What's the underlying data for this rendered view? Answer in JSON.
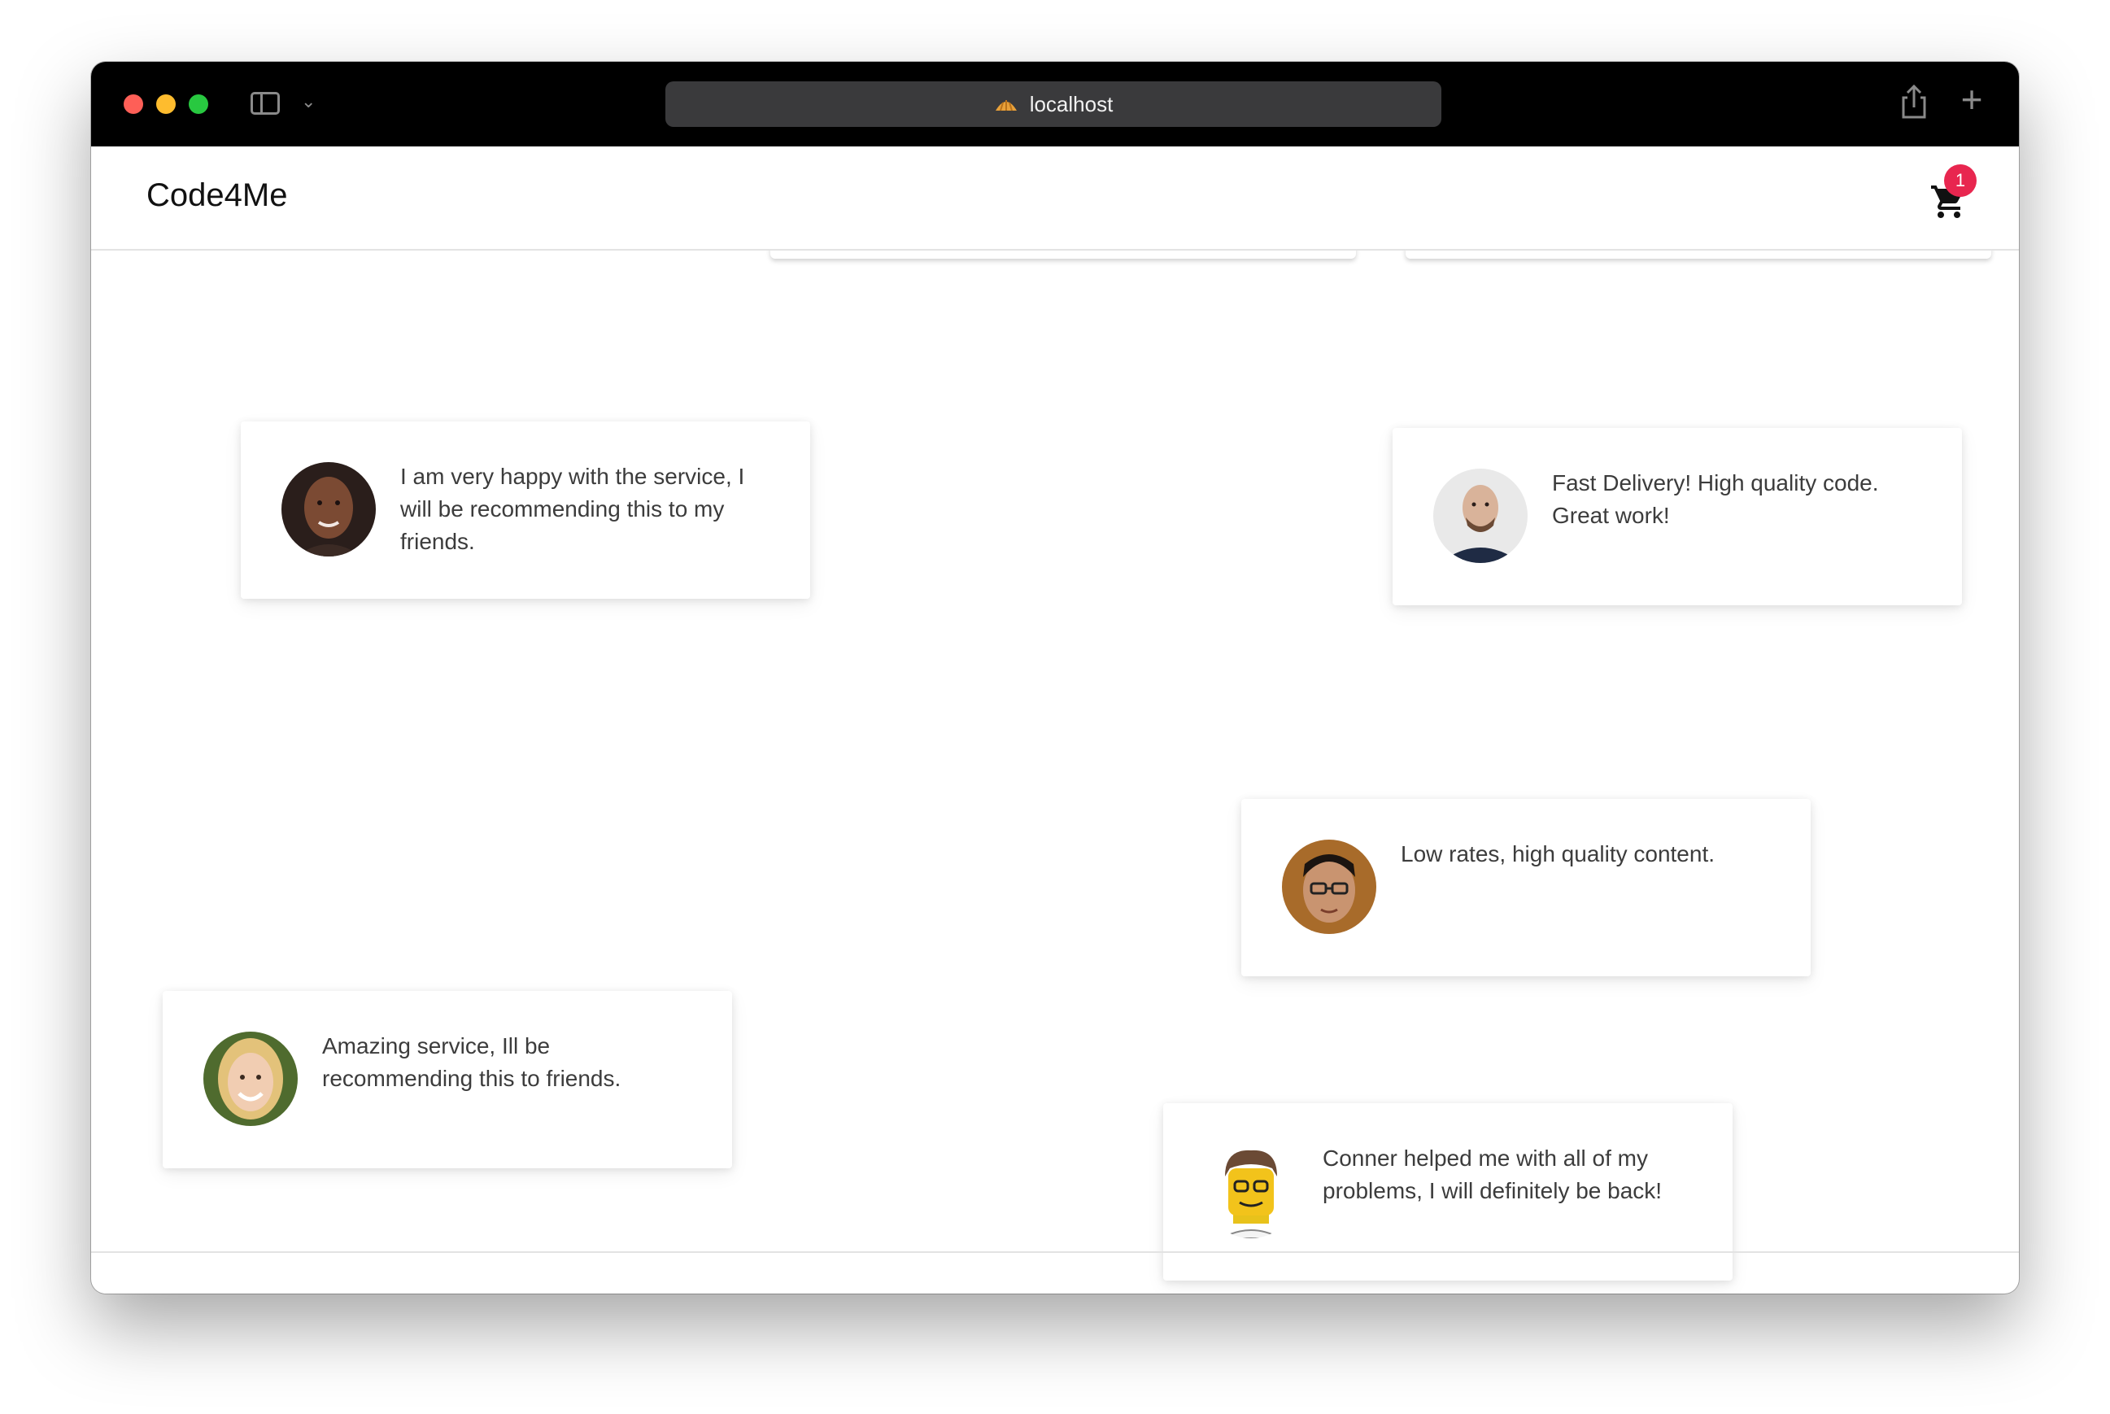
{
  "browser": {
    "address": "localhost"
  },
  "header": {
    "brand": "Code4Me",
    "cart_count": "1"
  },
  "testimonials": [
    {
      "avatar": "avatar-woman-dark-hair",
      "text": "I am very happy with the service, I will be recommending this to my friends."
    },
    {
      "avatar": "avatar-man-bald",
      "text": "Fast Delivery! High quality code. Great work!"
    },
    {
      "avatar": "avatar-man-glasses",
      "text": "Low rates, high quality content."
    },
    {
      "avatar": "avatar-woman-blonde",
      "text": "Amazing service, Ill be recommending this to friends."
    },
    {
      "avatar": "avatar-lego-figure",
      "text": "Conner helped me with all of my problems, I will definitely be back!"
    }
  ],
  "colors": {
    "badge": "#e8264f",
    "titlebar": "#000000",
    "addressbar": "#3a3a3c"
  }
}
